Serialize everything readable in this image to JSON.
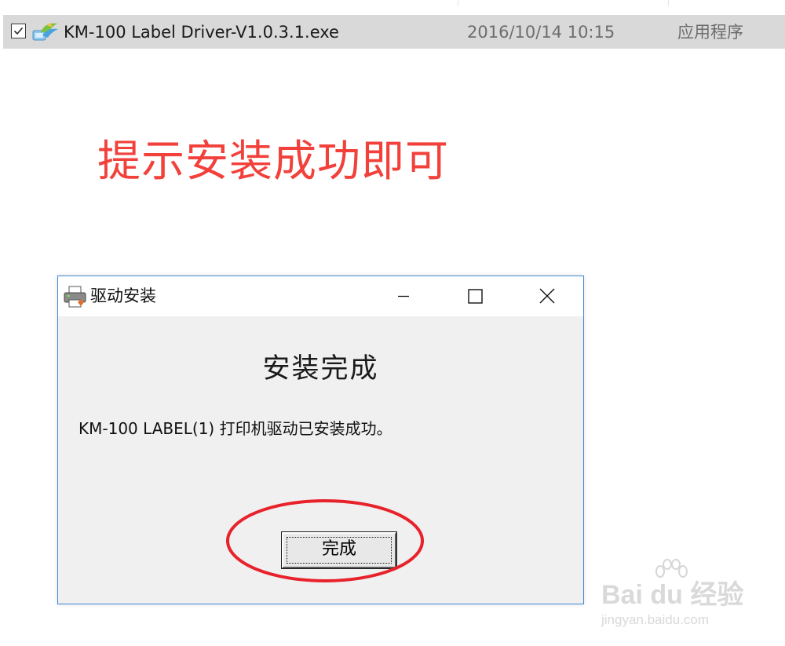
{
  "file_row": {
    "checked": true,
    "file_name": "KM-100 Label Driver-V1.0.3.1.exe",
    "modified": "2016/10/14 10:15",
    "type": "应用程序"
  },
  "annotation": {
    "text": "提示安装成功即可",
    "color": "#f2413b"
  },
  "dialog": {
    "title": "驱动安装",
    "heading": "安装完成",
    "message": "KM-100 LABEL(1) 打印机驱动已安装成功。",
    "finish_button": "完成",
    "border_color": "#3f86d6"
  },
  "watermark": {
    "brand": "Bai du 经验",
    "url": "jingyan.baidu.com"
  },
  "icons": {
    "checkbox": "checkbox-checked-icon",
    "file": "installer-exe-icon",
    "dialog": "printer-icon",
    "minimize": "minimize-icon",
    "maximize": "maximize-icon",
    "close": "close-icon",
    "watermark": "baidu-paw-icon"
  }
}
